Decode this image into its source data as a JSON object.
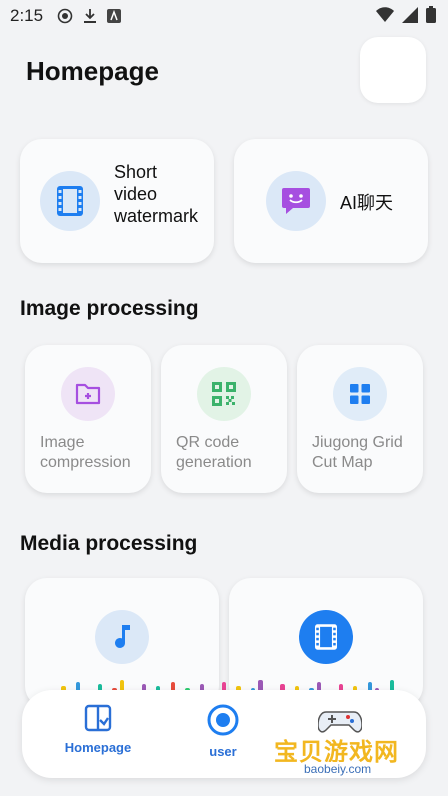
{
  "status_bar": {
    "time": "2:15"
  },
  "header": {
    "title": "Homepage"
  },
  "top_cards": [
    {
      "label": "Short video watermarking"
    },
    {
      "label": "AI聊天"
    }
  ],
  "sections": {
    "image": {
      "title": "Image processing",
      "items": [
        {
          "label": "Image compression"
        },
        {
          "label": "QR code generation"
        },
        {
          "label": "Jiugong Grid Cut Map"
        }
      ]
    },
    "media": {
      "title": "Media processing"
    }
  },
  "bottom_nav": {
    "home_label": "Homepage",
    "user_label": "user"
  },
  "watermark": {
    "text": "宝贝游戏网",
    "domain": "baobeiy.com"
  },
  "colors": {
    "accent": "#1e7ef0",
    "nav_active": "#2a6fd6",
    "background": "#f2f3f5"
  }
}
